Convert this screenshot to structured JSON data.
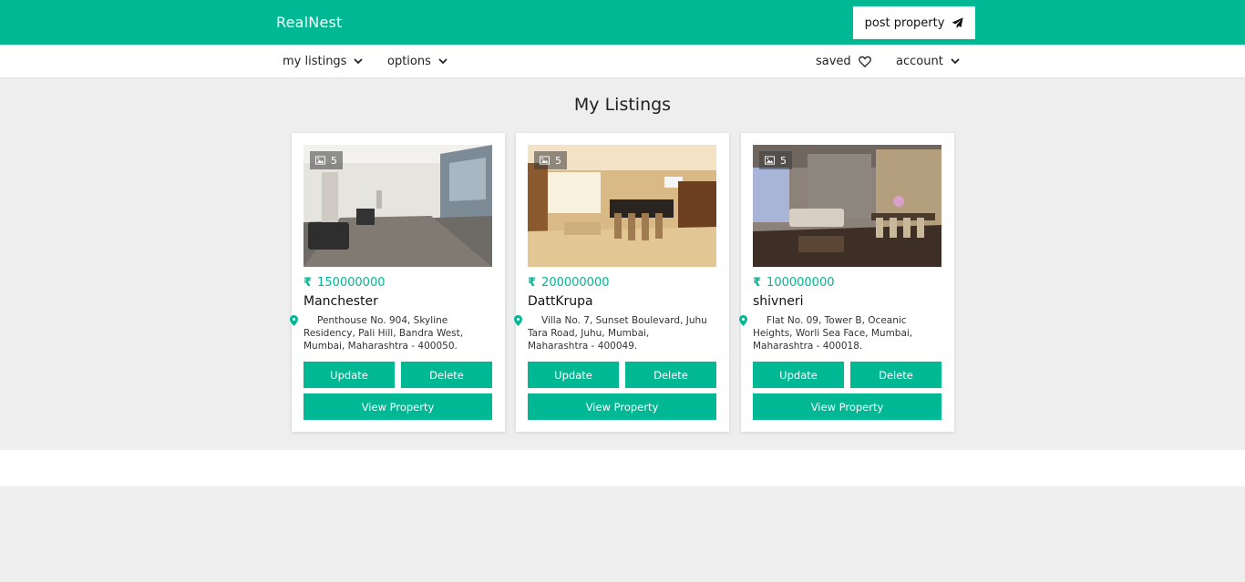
{
  "header": {
    "brand": "RealNest",
    "post_button_label": "post property"
  },
  "nav": {
    "my_listings": "my listings",
    "options": "options",
    "saved": "saved",
    "account": "account"
  },
  "page": {
    "title": "My Listings"
  },
  "colors": {
    "accent": "#00b894",
    "background": "#eeeeee"
  },
  "listings": [
    {
      "photo_count": "5",
      "price": "150000000",
      "name": "Manchester",
      "address": "Penthouse No. 904, Skyline Residency, Pali Hill, Bandra West, Mumbai, Maharashtra - 400050.",
      "update_label": "Update",
      "delete_label": "Delete",
      "view_label": "View Property"
    },
    {
      "photo_count": "5",
      "price": "200000000",
      "name": "DattKrupa",
      "address": "Villa No. 7, Sunset Boulevard, Juhu Tara Road, Juhu, Mumbai, Maharashtra - 400049.",
      "update_label": "Update",
      "delete_label": "Delete",
      "view_label": "View Property"
    },
    {
      "photo_count": "5",
      "price": "100000000",
      "name": "shivneri",
      "address": "Flat No. 09, Tower B, Oceanic Heights, Worli Sea Face, Mumbai, Maharashtra - 400018.",
      "update_label": "Update",
      "delete_label": "Delete",
      "view_label": "View Property"
    }
  ]
}
